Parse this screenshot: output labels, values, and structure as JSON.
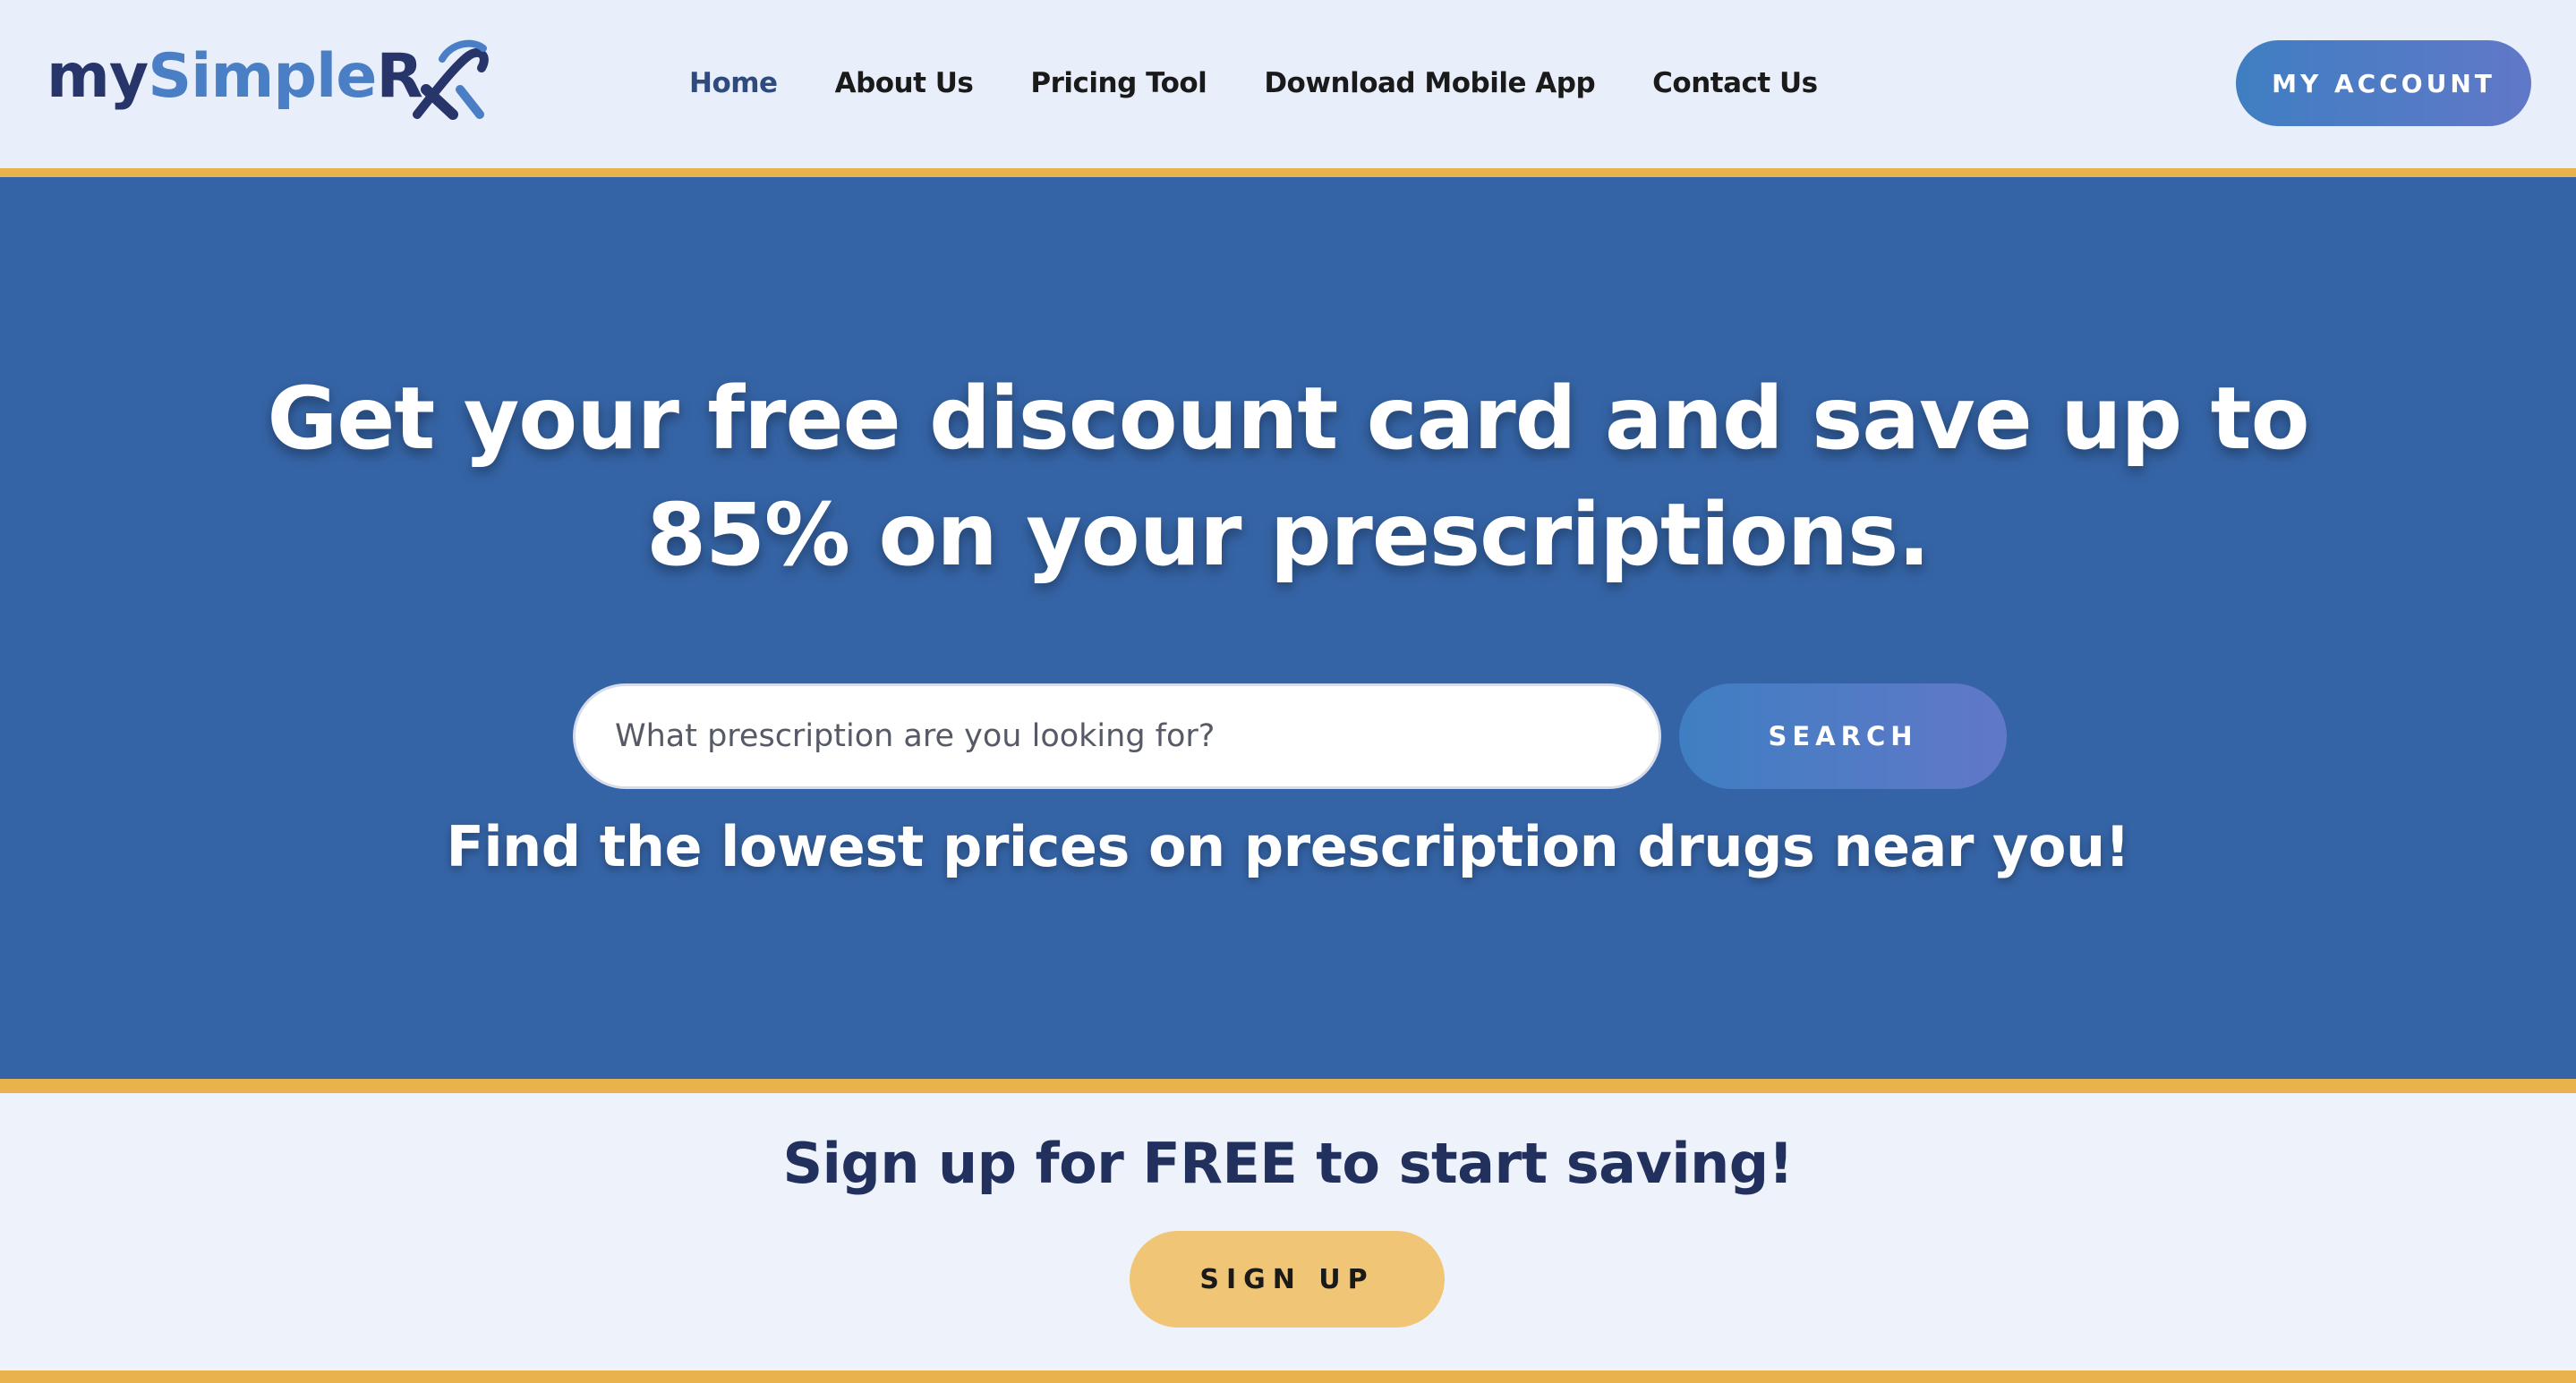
{
  "header": {
    "logo": {
      "part1": "my",
      "part2": "Simple",
      "part3": "R"
    },
    "nav": [
      {
        "label": "Home",
        "active": true
      },
      {
        "label": "About Us",
        "active": false
      },
      {
        "label": "Pricing Tool",
        "active": false
      },
      {
        "label": "Download Mobile App",
        "active": false
      },
      {
        "label": "Contact Us",
        "active": false
      }
    ],
    "account_button": "MY ACCOUNT"
  },
  "hero": {
    "title_line1": "Get your free discount card and save up to",
    "title_line2": "85% on your prescriptions.",
    "search_placeholder": "What prescription are you looking for?",
    "search_button": "SEARCH",
    "subtitle": "Find the lowest prices on prescription drugs near you!"
  },
  "signup": {
    "title": "Sign up for FREE to start saving!",
    "button": "SIGN UP"
  },
  "colors": {
    "header_bg": "#e9effa",
    "hero_bg": "#3564a6",
    "accent_gold": "#e9b24c",
    "button_gold": "#f0c676",
    "button_gradient_start": "#3f7ec2",
    "button_gradient_end": "#6178c8",
    "navy": "#22305e"
  }
}
